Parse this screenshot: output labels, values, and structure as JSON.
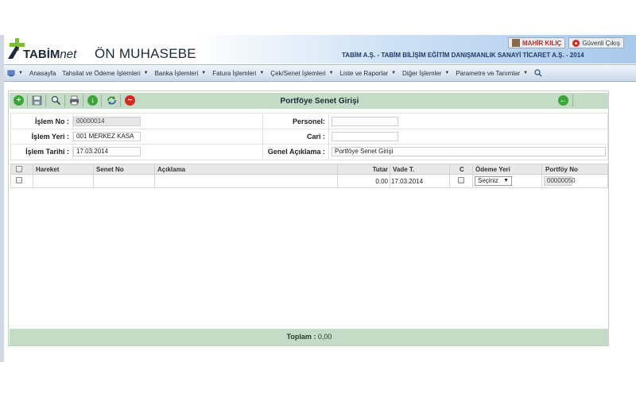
{
  "header": {
    "logo_main": "TABİM",
    "logo_suffix": "net",
    "app_title": "ÖN MUHASEBE",
    "user_name": "MAHİR KILIÇ",
    "logout_label": "Güvenli Çıkış",
    "company": "TABİM A.Ş. - TABİM BİLİŞİM EĞİTİM DANIŞMANLIK SANAYİ TİCARET A.Ş. - 2014"
  },
  "menu": {
    "items": [
      {
        "label": "Anasayfa",
        "caret": false
      },
      {
        "label": "Tahsilat ve Ödeme İşlemleri",
        "caret": true
      },
      {
        "label": "Banka İşlemleri",
        "caret": true
      },
      {
        "label": "Fatura İşlemleri",
        "caret": true
      },
      {
        "label": "Çek/Senet İşlemleri",
        "caret": true
      },
      {
        "label": "Liste ve Raporlar",
        "caret": true
      },
      {
        "label": "Diğer İşlemler",
        "caret": true
      },
      {
        "label": "Parametre ve Tanımlar",
        "caret": true
      }
    ],
    "home_icon": "home-icon",
    "search_icon": "search-icon"
  },
  "panel": {
    "title": "Portföye Senet Girişi",
    "toolbar_icons": [
      "add-icon",
      "save-icon",
      "search-icon",
      "print-icon",
      "download-icon",
      "refresh-icon",
      "delete-icon"
    ],
    "back_icon": "back-icon"
  },
  "form": {
    "islem_no_label": "İşlem No :",
    "islem_no_value": "00000014",
    "islem_yeri_label": "İşlem Yeri :",
    "islem_yeri_value": "001 MERKEZ KASA",
    "islem_tarihi_label": "İşlem Tarihi :",
    "islem_tarihi_value": "17.03.2014",
    "personel_label": "Personel:",
    "personel_value": "",
    "cari_label": "Cari :",
    "cari_value": "",
    "aciklama_label": "Genel Açıklama :",
    "aciklama_value": "Portföye Senet Girişi"
  },
  "grid": {
    "headers": {
      "hareket": "Hareket",
      "senet_no": "Senet No",
      "aciklama": "Açıklama",
      "tutar": "Tutar",
      "vade": "Vade T.",
      "c": "C",
      "odeme_yeri": "Ödeme Yeri",
      "portfoy_no": "Portföy No"
    },
    "row": {
      "hareket": "",
      "senet_no": "",
      "aciklama": "",
      "tutar": "0,00",
      "vade": "17.03.2014",
      "odeme_yeri": "Seçiniz",
      "portfoy_no": "00000050"
    }
  },
  "footer": {
    "label": "Toplam :",
    "value": "0,00"
  },
  "colors": {
    "toolbar_bg": "#c4dcc6",
    "menu_bg": "#c9d9ea",
    "accent_green": "#3aa63a",
    "accent_red": "#d12a22"
  }
}
